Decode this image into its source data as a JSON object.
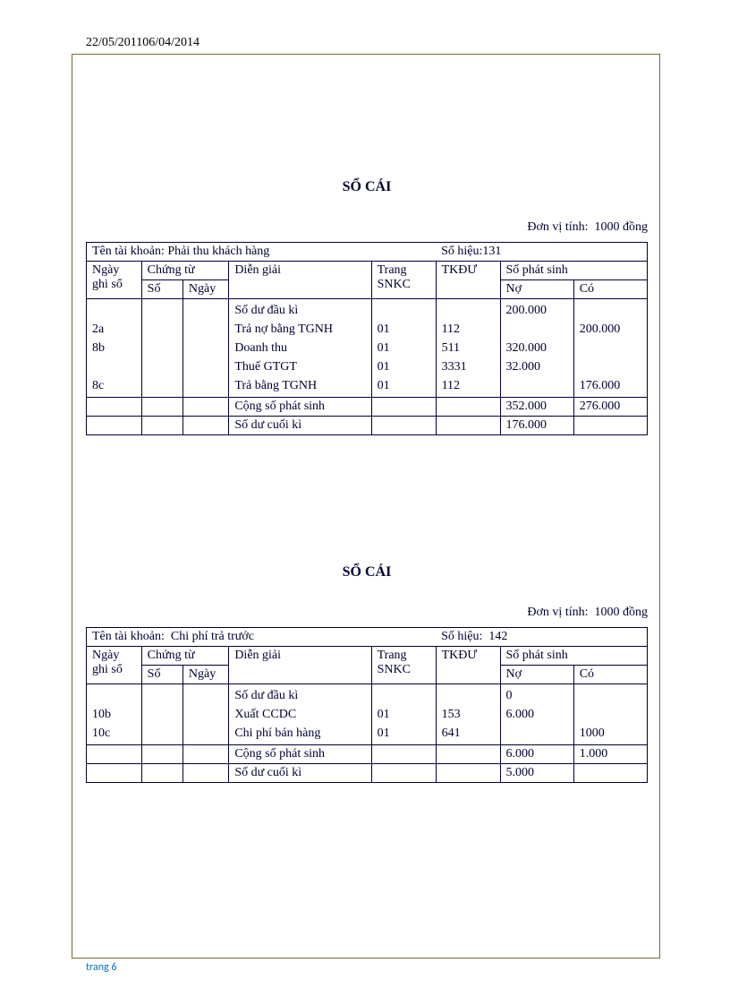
{
  "header_date": "22/05/201106/04/2014",
  "footer": "trang 6",
  "ledger1": {
    "title": "SỔ CÁI",
    "unit_label": "Đơn vị tính:",
    "unit_value": "1000 đồng",
    "account_name_label": "Tên tài khoản:",
    "account_name": "Phải thu khách hàng",
    "account_code_label": "Số hiệu:",
    "account_code": "131",
    "col_ngay_ghi_so": "Ngày ghi sổ",
    "col_chung_tu": "Chứng từ",
    "col_so": "Số",
    "col_ngay": "Ngày",
    "col_dien_giai": "Diễn giải",
    "col_trang_snkc": "Trang SNKC",
    "col_tkdu": "TKĐƯ",
    "col_so_phat_sinh": "Số phát sinh",
    "col_no": "Nợ",
    "col_co": "Có",
    "ngay_cells": "\n2a\n8b\n\n8c",
    "dien_giai_cells": "Số dư đầu kì\nTrả nợ bằng TGNH\nDoanh thu\nThuế GTGT\nTrả bằng TGNH",
    "trang_cells": "\n01\n01\n01\n01",
    "tkdu_cells": "\n112\n511\n3331\n112",
    "no_cells": "200.000\n\n320.000\n32.000\n",
    "co_cells": "\n200.000\n\n\n176.000",
    "sum_label": "Cộng số phát sinh",
    "sum_no": "352.000",
    "sum_co": "276.000",
    "closing_label": "Số dư cuối kì",
    "closing_no": "176.000"
  },
  "ledger2": {
    "title": "SỔ CÁI",
    "unit_label": "Đơn vị tính:",
    "unit_value": "1000 đồng",
    "account_name_label": "Tên tài khoản:",
    "account_name": "Chi phí trả trước",
    "account_code_label": "Số hiệu:",
    "account_code": "142",
    "col_ngay_ghi_so": "Ngày ghi sổ",
    "col_chung_tu": "Chứng từ",
    "col_so": "Số",
    "col_ngay": "Ngày",
    "col_dien_giai": "Diễn giải",
    "col_trang_snkc": "Trang SNKC",
    "col_tkdu": "TKĐƯ",
    "col_so_phat_sinh": "Số phát sinh",
    "col_no": "Nợ",
    "col_co": "Có",
    "ngay_cells": "\n10b\n10c",
    "dien_giai_cells": "Số dư đầu kì\nXuất CCDC\nChi phí bán hàng",
    "trang_cells": "\n01\n01",
    "tkdu_cells": "\n153\n641",
    "no_cells": "0\n6.000\n",
    "co_cells": "\n\n1000",
    "sum_label": "Cộng số phát sinh",
    "sum_no": "6.000",
    "sum_co": "1.000",
    "closing_label": "Số dư cuối kì",
    "closing_no": "5.000"
  }
}
